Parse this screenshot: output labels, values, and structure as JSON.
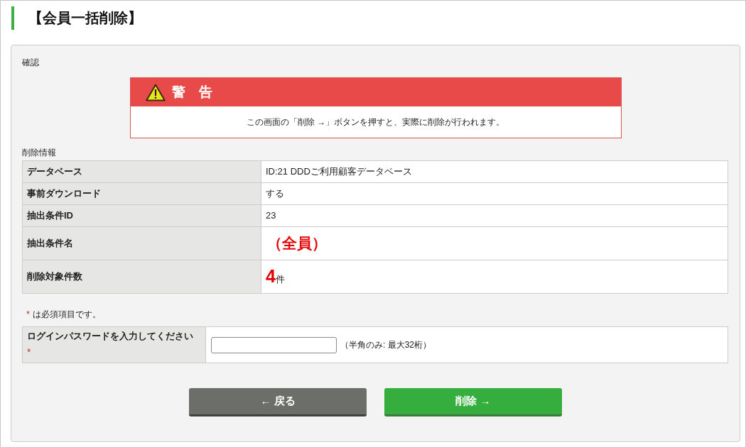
{
  "page_title": "【会員一括削除】",
  "panel": {
    "title": "確認",
    "warning": {
      "title": "警　告",
      "message": "この画面の「削除 →」ボタンを押すと、実際に削除が行われます。"
    },
    "delete_info": {
      "title": "削除情報",
      "rows": [
        {
          "kind": "plain",
          "label": "データベース",
          "value": "ID:21 DDDご利用顧客データベース"
        },
        {
          "kind": "plain",
          "label": "事前ダウンロード",
          "value": "する"
        },
        {
          "kind": "plain",
          "label": "抽出条件ID",
          "value": "23"
        },
        {
          "kind": "emphasis",
          "label": "抽出条件名",
          "value": "（全員）"
        },
        {
          "kind": "count",
          "label": "削除対象件数",
          "value": "4",
          "unit": "件"
        }
      ]
    },
    "required_note": {
      "mark": "*",
      "text": "は必須項目です。"
    },
    "password": {
      "label": "ログインパスワードを入力してください",
      "required_mark": "*",
      "hint": "（半角のみ: 最大32桁）"
    },
    "buttons": [
      {
        "kind": "back",
        "label": "← 戻る"
      },
      {
        "kind": "delete",
        "label": "削除 →"
      }
    ]
  }
}
